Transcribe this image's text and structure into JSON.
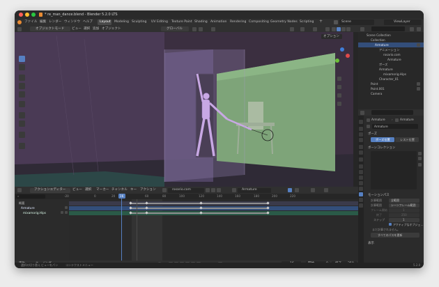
{
  "window": {
    "title": "* re_man_dance.blend - Blender 5.2.0 LTS"
  },
  "menu": [
    "ファイル",
    "編集",
    "レンダー",
    "ウィンドウ",
    "ヘルプ"
  ],
  "workspaces": [
    "Layout",
    "Modeling",
    "Sculpting",
    "UV Editing",
    "Texture Paint",
    "Shading",
    "Animation",
    "Rendering",
    "Compositing",
    "Geometry Nodes",
    "Scripting"
  ],
  "topright": {
    "scene": "Scene",
    "viewlayer": "ViewLayer"
  },
  "viewport": {
    "mode": "オブジェクトモード",
    "menus": [
      "ビュー",
      "選択",
      "追加",
      "オブジェクト"
    ],
    "orientation": "グローバル",
    "options_label": "オプション"
  },
  "timeline": {
    "editor": "アクションエディター",
    "menus": [
      "ビュー",
      "選択",
      "マーカー",
      "チャンネル",
      "キー",
      "アクション"
    ],
    "action": "rosario.com",
    "object": "Armature",
    "frame_numbers": [
      "-20",
      "0",
      "20",
      "40",
      "60",
      "80",
      "100",
      "120",
      "140",
      "160",
      "180",
      "200",
      "220"
    ],
    "current_frame": "16",
    "channels": [
      "概要",
      "Armature",
      "mixamorig.Hips"
    ],
    "footer": {
      "play_mode": "再生",
      "keying": "キーイング",
      "frame_current": "16",
      "start_label": "開始",
      "start": "0",
      "end_label": "終了",
      "end": "250"
    }
  },
  "statusbar": [
    "選択の切り替え",
    "ビューをパン",
    "コンテクストメニュー"
  ],
  "version": "5.2.0",
  "outliner": {
    "search_placeholder": "",
    "items": [
      {
        "label": "Scene Collection",
        "depth": 0
      },
      {
        "label": "Collection",
        "depth": 1
      },
      {
        "label": "Armature",
        "depth": 2
      },
      {
        "label": "アニメーション",
        "depth": 3
      },
      {
        "label": "rosario.com",
        "depth": 4
      },
      {
        "label": "Armature",
        "depth": 4
      },
      {
        "label": "ポーズ",
        "depth": 3
      },
      {
        "label": "Armature",
        "depth": 3
      },
      {
        "label": "mixamorig.Hips",
        "depth": 4
      },
      {
        "label": "Character_01",
        "depth": 3
      },
      {
        "label": "Point",
        "depth": 1
      },
      {
        "label": "Point.001",
        "depth": 1
      },
      {
        "label": "Camera",
        "depth": 1
      }
    ]
  },
  "properties": {
    "breadcrumb_obj": "Armature",
    "breadcrumb_data": "Armature",
    "name": "Armature",
    "pose_section": "ポーズ",
    "pose_position": "ポーズ位置",
    "rest_position": "レスト位置",
    "bone_collections": "ボーンコレクション",
    "motion_paths": "モーションパス",
    "calc_label": "計算範囲",
    "calc_value": "全範囲",
    "range_label": "計算範囲",
    "range_value": "シーンフレーム範囲",
    "frame_start_label": "フレーム開始",
    "frame_start": "1",
    "frame_end_label": "終了",
    "frame_end": "250",
    "step_label": "ステップ",
    "step": "1",
    "checkbox": "アクティブなオブジェ…",
    "nothing_calc": "まだ計算されません。",
    "calc_button": "すべてのパスを更新",
    "display_section": "表示"
  },
  "colors": {
    "accent": "#5680c2",
    "header": "#303030",
    "panel": "#2b2b2b",
    "timeline_blue": "#5680c2"
  }
}
